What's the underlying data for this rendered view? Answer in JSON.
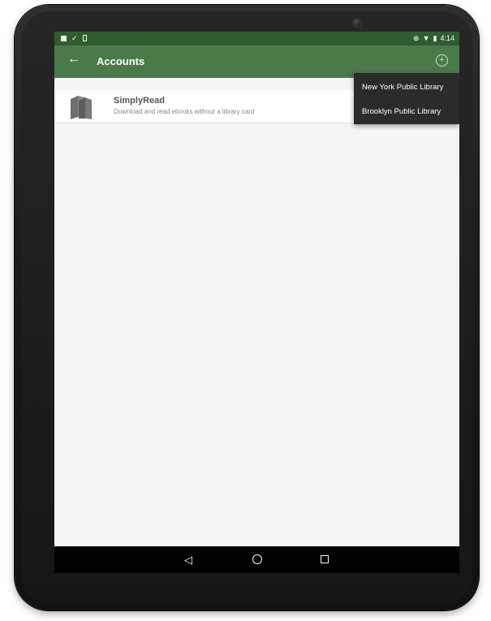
{
  "status_bar": {
    "time": "4:14",
    "left_icons": [
      "notification-icon",
      "check-icon",
      "phone-icon"
    ],
    "right_icons": [
      "vibrate-icon",
      "wifi-icon",
      "battery-icon"
    ]
  },
  "app_bar": {
    "title": "Accounts",
    "back_icon": "arrow-left-icon",
    "add_icon": "add-circle-icon",
    "color": "#4a7a4a"
  },
  "accounts": [
    {
      "name": "SimplyRead",
      "description": "Download and read ebooks without a library card",
      "icon": "books-icon"
    }
  ],
  "dropdown": {
    "items": [
      "New York Public Library",
      "Brooklyn Public Library"
    ]
  },
  "nav_bar": {
    "icons": [
      "back-triangle-icon",
      "home-circle-icon",
      "recents-square-icon"
    ]
  },
  "colors": {
    "status_bar": "#2e5e2e",
    "app_bar": "#4a7a4a",
    "dropdown_bg": "#2b2b2b",
    "screen_bg": "#f4f4f4"
  }
}
